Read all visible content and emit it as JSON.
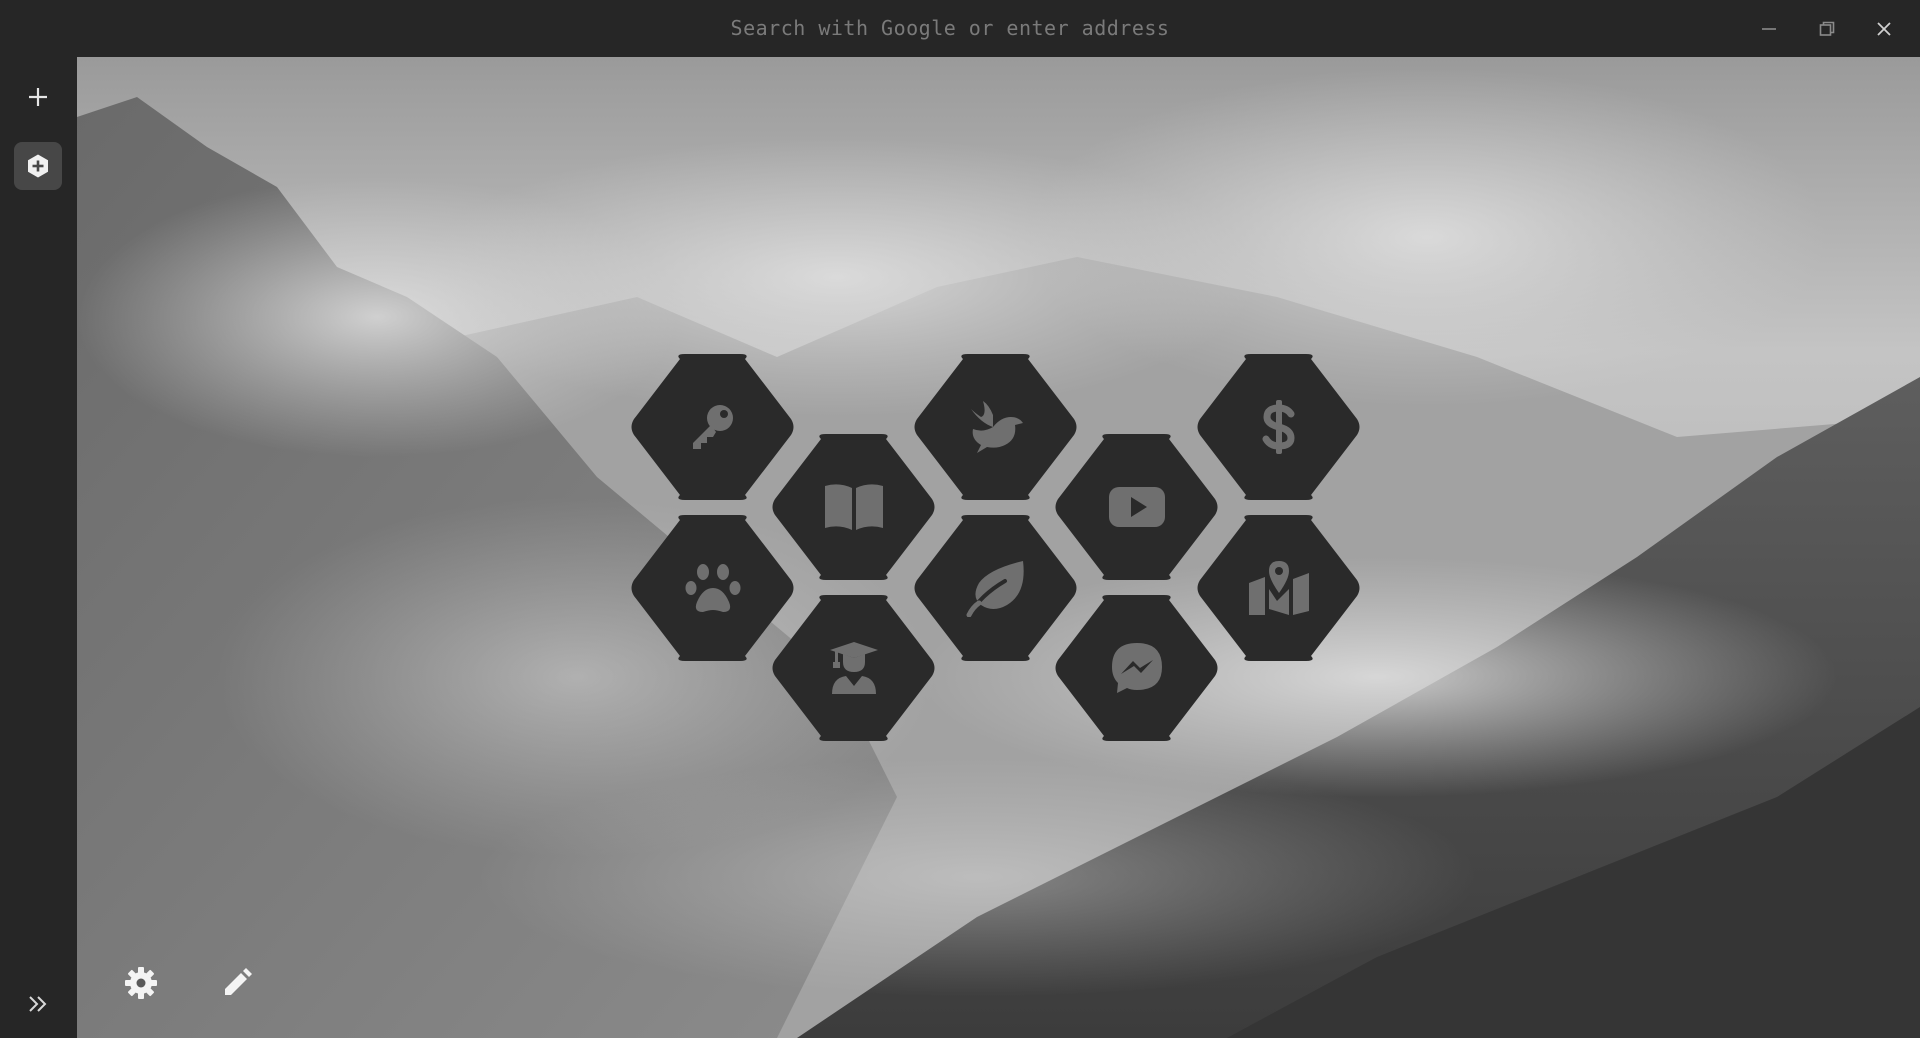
{
  "address_bar": {
    "placeholder": "Search with Google or enter address"
  },
  "window_controls": [
    "minimize-icon",
    "restore-icon",
    "close-icon"
  ],
  "sidebar": {
    "items": [
      {
        "icon": "plus-icon",
        "active": false
      },
      {
        "icon": "add-circle-icon",
        "active": true
      }
    ],
    "bottom_icon": "double-chevron-right-icon"
  },
  "speed_dial": {
    "tiles": [
      {
        "icon": "key-icon"
      },
      {
        "icon": "book-icon"
      },
      {
        "icon": "dove-icon"
      },
      {
        "icon": "youtube-icon"
      },
      {
        "icon": "dollar-icon"
      },
      {
        "icon": "paw-icon"
      },
      {
        "icon": "graduate-icon"
      },
      {
        "icon": "leaf-icon"
      },
      {
        "icon": "messenger-icon"
      },
      {
        "icon": "map-location-icon"
      }
    ]
  },
  "bottom_toolbar": {
    "icons": [
      "gear-icon",
      "pencil-icon"
    ]
  },
  "colors": {
    "chrome": "#262626",
    "tile": "#2a2a2a",
    "tile_icon": "#6f6f6f",
    "placeholder_text": "#7a7a7a",
    "active_sidebar": "#474747"
  }
}
